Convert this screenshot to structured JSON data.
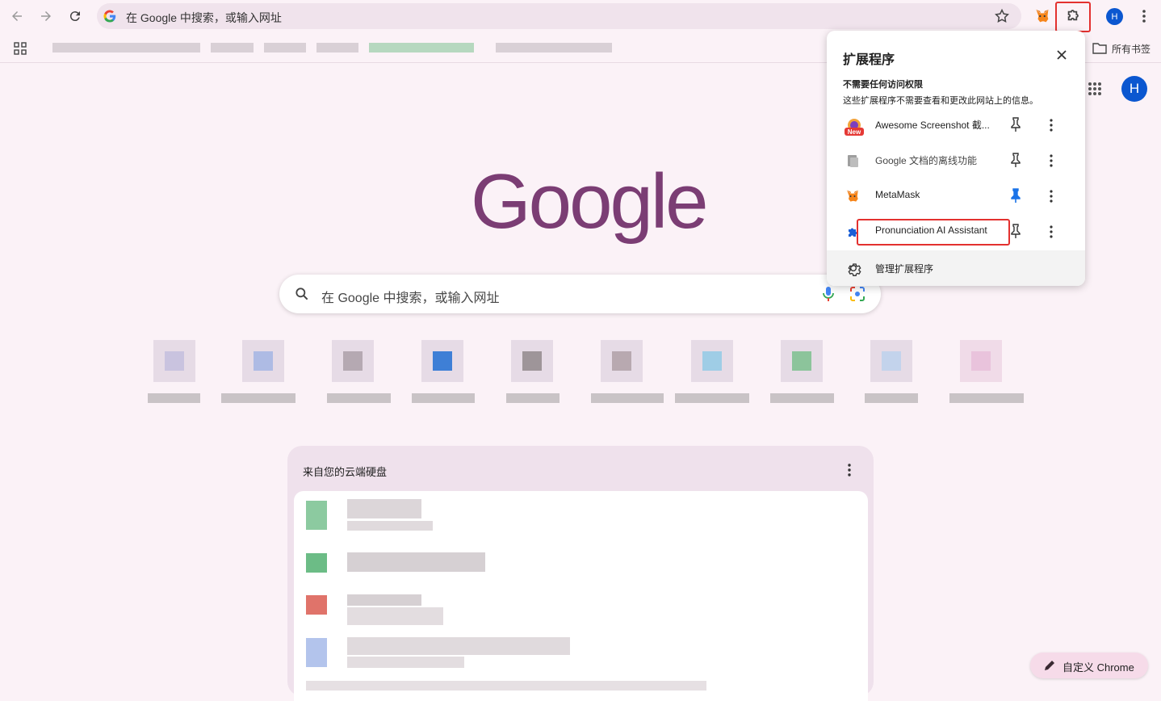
{
  "toolbar": {
    "omnibox_text": "在 Google 中搜索，或输入网址",
    "profile_initial": "H"
  },
  "bookmarks": {
    "all_bookmarks_label": "所有书签"
  },
  "ntp": {
    "logo_text": "Google",
    "search_placeholder": "在 Google 中搜索，或输入网址",
    "profile_initial": "H",
    "drive_title": "来自您的云端硬盘",
    "customize_label": "自定义 Chrome"
  },
  "extensions_popup": {
    "title": "扩展程序",
    "section_heading": "不需要任何访问权限",
    "section_desc": "这些扩展程序不需要查看和更改此网站上的信息。",
    "items": [
      {
        "name": "Awesome Screenshot 截...",
        "badge": "New",
        "pinned": false
      },
      {
        "name": "Google 文档的离线功能",
        "pinned": false
      },
      {
        "name": "MetaMask",
        "pinned": true
      },
      {
        "name": "Pronunciation AI Assistant",
        "pinned": false
      }
    ],
    "manage_label": "管理扩展程序"
  },
  "colors": {
    "background": "#fbf2f7",
    "logo": "#7b3d74",
    "highlight": "#e3312f",
    "pin_active": "#1a73e8",
    "avatar": "#0b57d0"
  }
}
